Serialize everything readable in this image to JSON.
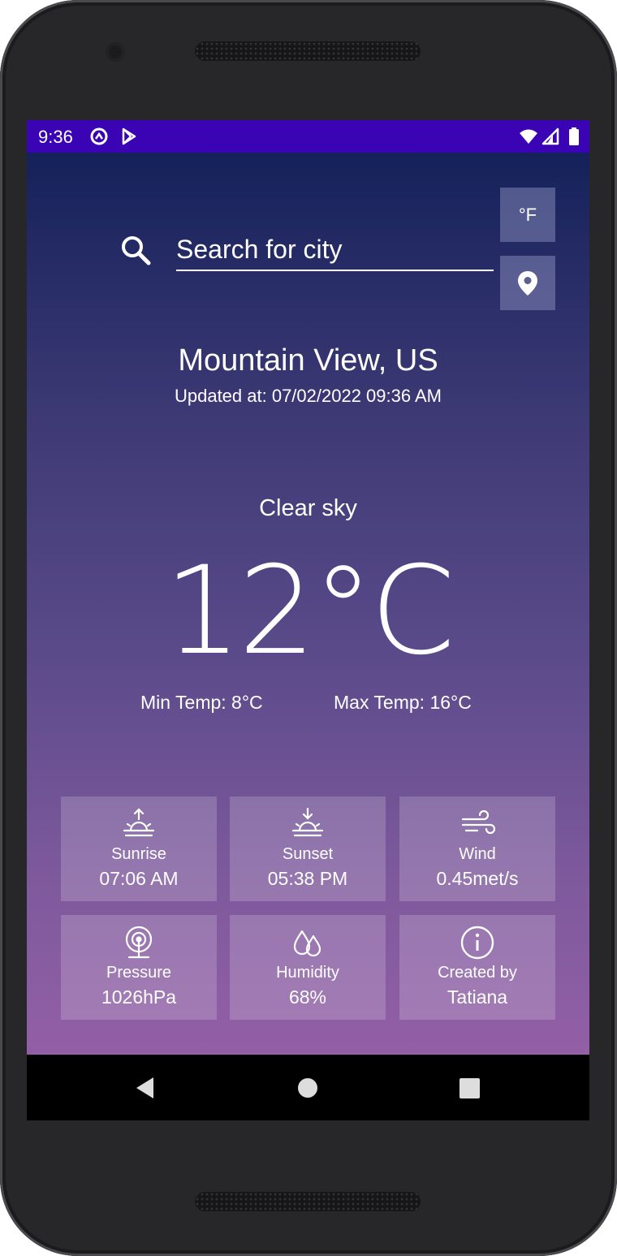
{
  "status_bar": {
    "time": "9:36"
  },
  "search": {
    "placeholder": "Search for city"
  },
  "unit_toggle": {
    "label": "°F"
  },
  "location": {
    "city": "Mountain View, US",
    "updated": "Updated at: 07/02/2022 09:36 AM"
  },
  "weather": {
    "description": "Clear sky",
    "temperature": "12°C",
    "min_temp": "Min Temp: 8°C",
    "max_temp": "Max Temp: 16°C"
  },
  "details": [
    {
      "icon": "sunrise-icon",
      "label": "Sunrise",
      "value": "07:06 AM"
    },
    {
      "icon": "sunset-icon",
      "label": "Sunset",
      "value": "05:38 PM"
    },
    {
      "icon": "wind-icon",
      "label": "Wind",
      "value": "0.45met/s"
    },
    {
      "icon": "pressure-icon",
      "label": "Pressure",
      "value": "1026hPa"
    },
    {
      "icon": "humidity-icon",
      "label": "Humidity",
      "value": "68%"
    },
    {
      "icon": "info-icon",
      "label": "Created by",
      "value": "Tatiana"
    }
  ],
  "colors": {
    "status_bar": "#3a03b3",
    "gradient_top": "#15215a",
    "gradient_bottom": "#935fa6"
  }
}
